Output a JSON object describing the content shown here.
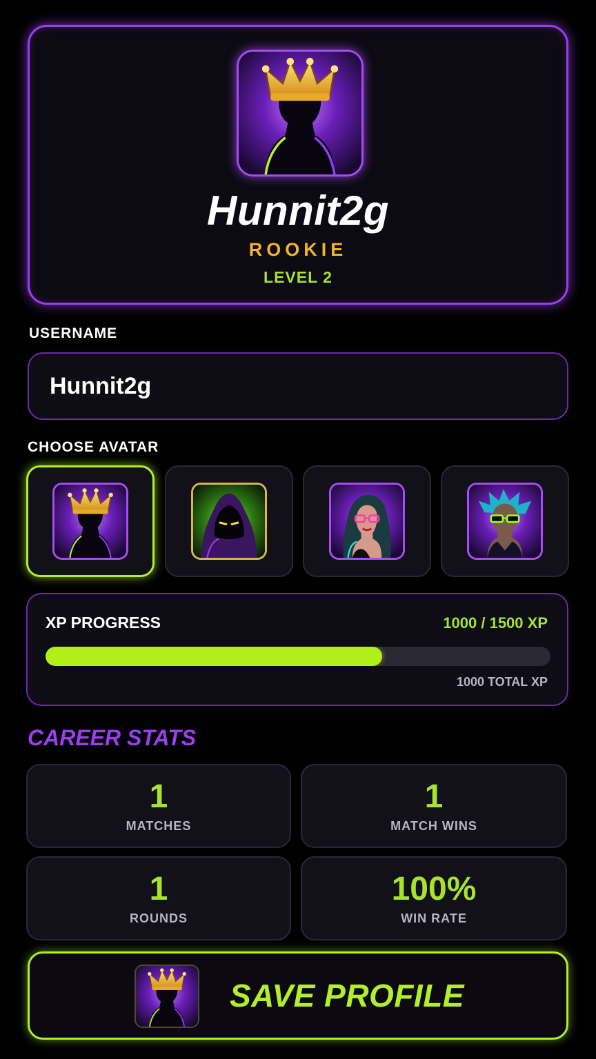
{
  "profile": {
    "display_name": "Hunnit2g",
    "rank": "ROOKIE",
    "level": "LEVEL 2",
    "avatar_icon": "crowned-silhouette-icon"
  },
  "username": {
    "label": "USERNAME",
    "value": "Hunnit2g"
  },
  "avatar_picker": {
    "label": "CHOOSE AVATAR",
    "options": [
      {
        "icon": "crowned-silhouette-icon",
        "selected": true
      },
      {
        "icon": "hooded-figure-icon",
        "selected": false
      },
      {
        "icon": "woman-with-glasses-icon",
        "selected": false
      },
      {
        "icon": "spiky-hair-with-shades-icon",
        "selected": false
      }
    ]
  },
  "xp": {
    "title": "XP PROGRESS",
    "amount": "1000 / 1500 XP",
    "current": 1000,
    "target": 1500,
    "total": "1000 TOTAL XP"
  },
  "career_stats": {
    "heading": "CAREER STATS",
    "items": [
      {
        "value": "1",
        "label": "MATCHES"
      },
      {
        "value": "1",
        "label": "MATCH WINS"
      },
      {
        "value": "1",
        "label": "ROUNDS"
      },
      {
        "value": "100%",
        "label": "WIN RATE"
      }
    ]
  },
  "save_button": {
    "label": "SAVE PROFILE",
    "icon": "crowned-silhouette-icon"
  },
  "colors": {
    "accent_purple": "#9b3df0",
    "accent_lime": "#b2ee2a",
    "rank_gold": "#f4b32a",
    "background": "#000000"
  }
}
